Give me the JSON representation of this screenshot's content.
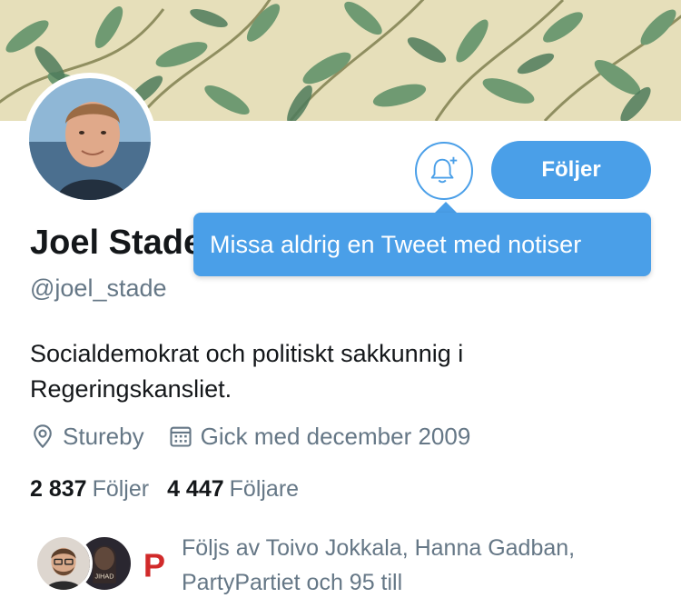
{
  "profile": {
    "name": "Joel Stade",
    "handle": "@joel_stade",
    "bio": "Socialdemokrat och politiskt sakkunnig i Regeringskansliet.",
    "location": "Stureby",
    "joined": "Gick med december 2009"
  },
  "actions": {
    "follow_label": "Följer",
    "notification_icon": "bell-plus-icon"
  },
  "tooltip": {
    "text": "Missa aldrig en Tweet med notiser"
  },
  "stats": {
    "following_count": "2 837",
    "following_label": "Följer",
    "followers_count": "4 447",
    "followers_label": "Följare"
  },
  "followed_by": {
    "text": "Följs av Toivo Jokkala, Hanna Gadban, PartyPartiet och 95 till",
    "avatar_3_text": "P",
    "avatar_2_text": "JIHAD"
  },
  "colors": {
    "accent": "#4a9fe8",
    "text_primary": "#14171a",
    "text_secondary": "#657786",
    "banner_bg": "#e3dcb6"
  }
}
